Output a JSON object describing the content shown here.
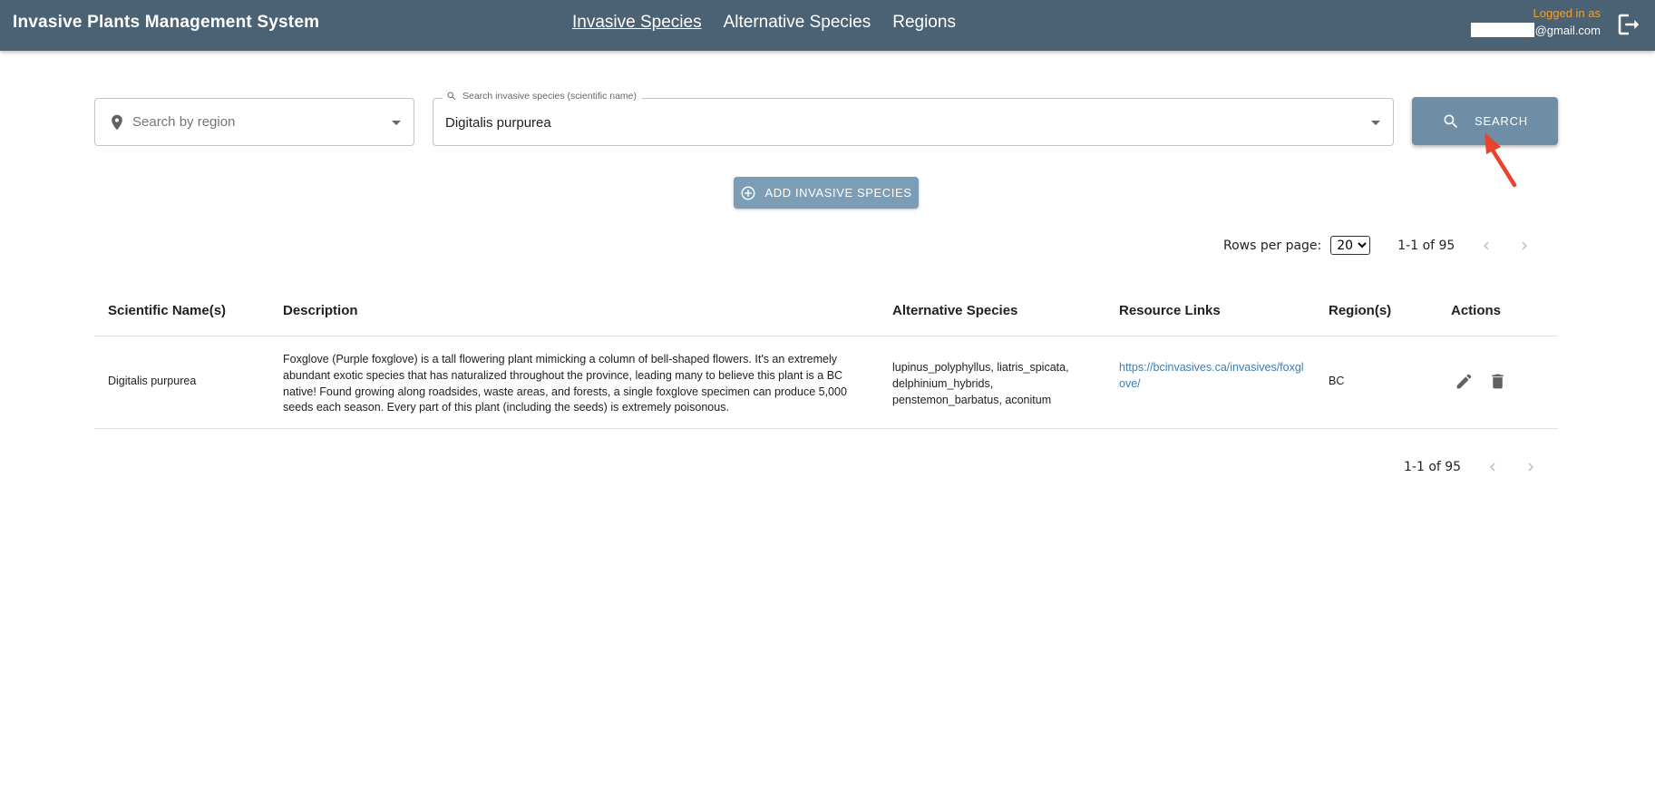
{
  "header": {
    "title": "Invasive Plants Management System",
    "nav": [
      {
        "label": "Invasive Species"
      },
      {
        "label": "Alternative Species"
      },
      {
        "label": "Regions"
      }
    ],
    "logged_in_label": "Logged in as",
    "email_suffix": "@gmail.com"
  },
  "search": {
    "region_placeholder": "Search by region",
    "species_label": "Search invasive species (scientific name)",
    "species_value": "Digitalis purpurea",
    "button_label": "SEARCH"
  },
  "add_button_label": "ADD INVASIVE SPECIES",
  "pagination": {
    "rows_per_page_label": "Rows per page:",
    "rows_per_page_value": "20",
    "range": "1-1 of 95"
  },
  "table": {
    "headers": [
      "Scientific Name(s)",
      "Description",
      "Alternative Species",
      "Resource Links",
      "Region(s)",
      "Actions"
    ],
    "rows": [
      {
        "scientific_name": "Digitalis purpurea",
        "description": "Foxglove (Purple foxglove) is a tall flowering plant mimicking a column of bell-shaped flowers. It's an extremely abundant exotic species that has naturalized throughout the province, leading many to believe this plant is a BC native! Found growing along roadsides, waste areas, and forests, a single foxglove specimen can produce 5,000 seeds each season. Every part of this plant (including the seeds) is extremely poisonous.",
        "alternative_species": "lupinus_polyphyllus, liatris_spicata, delphinium_hybrids, penstemon_barbatus, aconitum",
        "resource_link": "https://bcinvasives.ca/invasives/foxglove/",
        "region": "BC"
      }
    ]
  },
  "colors": {
    "header_bg": "#4a6274",
    "search_button": "#6f8ea6",
    "add_button": "#7b9db6",
    "link": "#3e7cb1",
    "logged_in": "#f0a030",
    "annotation_arrow": "#e8432d"
  },
  "icons": [
    "logout-icon",
    "location-pin-icon",
    "search-icon",
    "add-circle-icon",
    "chevron-left-icon",
    "chevron-right-icon",
    "edit-icon",
    "delete-icon"
  ]
}
